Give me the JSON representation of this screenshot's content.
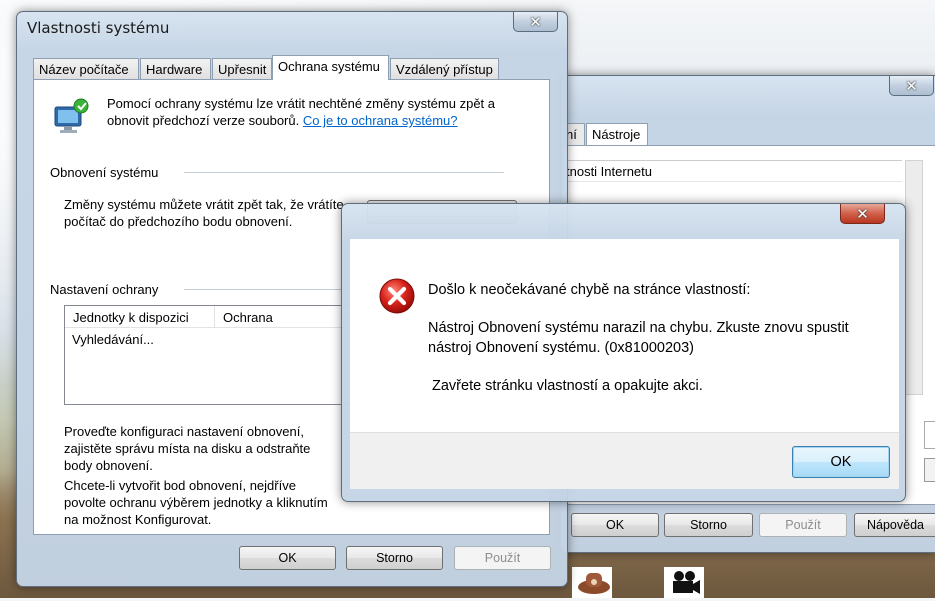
{
  "system_properties": {
    "title": "Vlastnosti systému",
    "tabs": [
      "Název počítače",
      "Hardware",
      "Upřesnit",
      "Ochrana systému",
      "Vzdálený přístup"
    ],
    "active_tab": "Ochrana systému",
    "intro_line1": "Pomocí ochrany systému lze vrátit nechtěné změny systému zpět a",
    "intro_line2_prefix": "obnovit předchozí verze souborů.",
    "intro_link": "Co je to ochrana systému?",
    "restore_group": "Obnovení systému",
    "restore_text_line1": "Změny systému můžete vrátit zpět tak, že vrátíte",
    "restore_text_line2": "počítač do předchozího bodu obnovení.",
    "protection_group": "Nastavení ochrany",
    "list_headers": [
      "Jednotky k dispozici",
      "Ochrana"
    ],
    "list_rows": [
      "Vyhledávání..."
    ],
    "config_text": [
      "Proveďte konfiguraci nastavení obnovení,",
      "zajistěte správu místa na disku a odstraňte",
      "body obnovení."
    ],
    "create_text": [
      "Chcete-li vytvořit bod obnovení, nejdříve",
      "povolte ochranu výběrem jednotky a kliknutím",
      "na možnost Konfigurovat."
    ],
    "buttons": {
      "ok": "OK",
      "cancel": "Storno",
      "apply": "Použít"
    }
  },
  "background_window": {
    "tab_partial": "ní",
    "tab_tools": "Nástroje",
    "list_item": "tnosti Internetu",
    "buttons": {
      "ok": "OK",
      "cancel": "Storno",
      "apply": "Použít",
      "help": "Nápověda"
    }
  },
  "error_dialog": {
    "heading": "Došlo k neočekávané chybě na stránce vlastností:",
    "message_line1": "Nástroj Obnovení systému narazil na chybu. Zkuste znovu spustit",
    "message_line2": "nástroj Obnovení systému. (0x81000203)",
    "instruction": "Zavřete stránku vlastností a opakujte akci.",
    "ok_label": "OK",
    "icon": "error-icon"
  },
  "close_glyph": "✕"
}
